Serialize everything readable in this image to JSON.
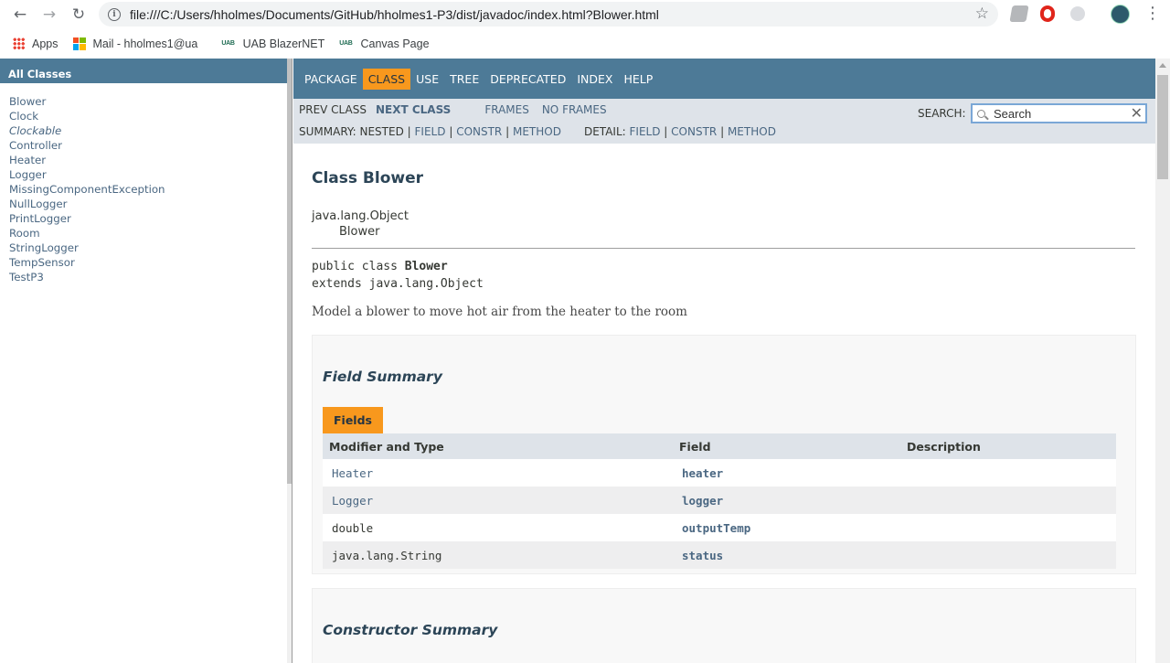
{
  "browser": {
    "url": "file:///C:/Users/hholmes/Documents/GitHub/hholmes1-P3/dist/javadoc/index.html?Blower.html",
    "bookmarks": [
      {
        "label": "Apps",
        "icon": "apps-grid-icon"
      },
      {
        "label": "Mail - hholmes1@ua",
        "icon": "microsoft-logo-icon"
      },
      {
        "label": "UAB BlazerNET",
        "icon": "uab-logo-icon"
      },
      {
        "label": "Canvas Page",
        "icon": "uab-logo-icon"
      }
    ]
  },
  "sidebar": {
    "heading": "All Classes",
    "classes": [
      {
        "name": "Blower",
        "italic": false
      },
      {
        "name": "Clock",
        "italic": false
      },
      {
        "name": "Clockable",
        "italic": true
      },
      {
        "name": "Controller",
        "italic": false
      },
      {
        "name": "Heater",
        "italic": false
      },
      {
        "name": "Logger",
        "italic": false
      },
      {
        "name": "MissingComponentException",
        "italic": false
      },
      {
        "name": "NullLogger",
        "italic": false
      },
      {
        "name": "PrintLogger",
        "italic": false
      },
      {
        "name": "Room",
        "italic": false
      },
      {
        "name": "StringLogger",
        "italic": false
      },
      {
        "name": "TempSensor",
        "italic": false
      },
      {
        "name": "TestP3",
        "italic": false
      }
    ]
  },
  "topnav": {
    "items": [
      "PACKAGE",
      "CLASS",
      "USE",
      "TREE",
      "DEPRECATED",
      "INDEX",
      "HELP"
    ],
    "active": "CLASS"
  },
  "subnav": {
    "prev_class": "PREV CLASS",
    "next_class": "NEXT CLASS",
    "frames": "FRAMES",
    "no_frames": "NO FRAMES",
    "summary_label": "SUMMARY:",
    "summary_nested": "NESTED",
    "summary_field": "FIELD",
    "summary_constr": "CONSTR",
    "summary_method": "METHOD",
    "detail_label": "DETAIL:",
    "detail_field": "FIELD",
    "detail_constr": "CONSTR",
    "detail_method": "METHOD",
    "sep": "|",
    "search_label": "SEARCH:",
    "search_value": "Search"
  },
  "main": {
    "class_title": "Class Blower",
    "inheritance_parent": "java.lang.Object",
    "inheritance_child": "Blower",
    "decl_prefix": "public class",
    "decl_name": "Blower",
    "decl_extends": "extends java.lang.Object",
    "description": "Model a blower to move hot air from the heater to the room",
    "field_summary": {
      "heading": "Field Summary",
      "tab_caption": "Fields",
      "columns": [
        "Modifier and Type",
        "Field",
        "Description"
      ],
      "rows": [
        {
          "type": "Heater",
          "field": "heater",
          "description": "",
          "type_link": true
        },
        {
          "type": "Logger",
          "field": "logger",
          "description": "",
          "type_link": true
        },
        {
          "type": "double",
          "field": "outputTemp",
          "description": "",
          "type_link": false
        },
        {
          "type": "java.lang.String",
          "field": "status",
          "description": "",
          "type_link": false
        }
      ]
    },
    "constructor_summary": {
      "heading": "Constructor Summary"
    }
  }
}
